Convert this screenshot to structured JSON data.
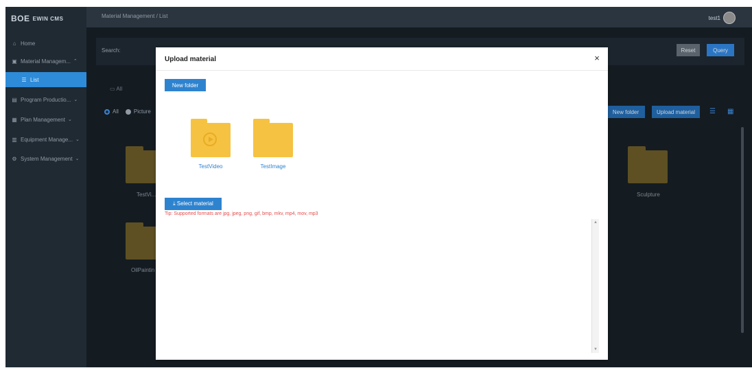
{
  "app": {
    "logo_brand": "BOE",
    "logo_sub": "EWIN CMS",
    "breadcrumb": "Material Management  /  List",
    "user": "test1"
  },
  "sidebar": {
    "items": [
      {
        "icon": "home-icon",
        "label": "Home",
        "caret": ""
      },
      {
        "icon": "image-icon",
        "label": "Material Managem...",
        "caret": "^"
      },
      {
        "icon": "list-icon",
        "label": "List",
        "caret": ""
      },
      {
        "icon": "document-icon",
        "label": "Program Productio...",
        "caret": "v"
      },
      {
        "icon": "calendar-icon",
        "label": "Plan Management",
        "caret": "v"
      },
      {
        "icon": "device-icon",
        "label": "Equipment Manage...",
        "caret": "v"
      },
      {
        "icon": "gear-icon",
        "label": "System Management",
        "caret": "v"
      }
    ]
  },
  "background": {
    "search_label": "Search:",
    "reset_label": "Reset",
    "query_label": "Query",
    "path_all": "All",
    "filter_all": "All",
    "filter_picture": "Picture",
    "new_folder_label": "New folder",
    "upload_label": "Upload material",
    "folders": [
      "TestVi...",
      "OilPaintin",
      "Sculpture"
    ]
  },
  "modal": {
    "title": "Upload material",
    "close": "×",
    "new_folder_label": "New folder",
    "folders": [
      {
        "name": "TestVideo",
        "has_play": true
      },
      {
        "name": "TestImage",
        "has_play": false
      }
    ],
    "select_label": "⤓  Select material",
    "tip": "Tip: Supported formats are jpg, jpeg, png, gif, bmp, mkv, mp4, mov, mp3"
  },
  "colors": {
    "accent": "#2e83cf",
    "folder": "#f6c242",
    "tip": "#e34b4b"
  }
}
